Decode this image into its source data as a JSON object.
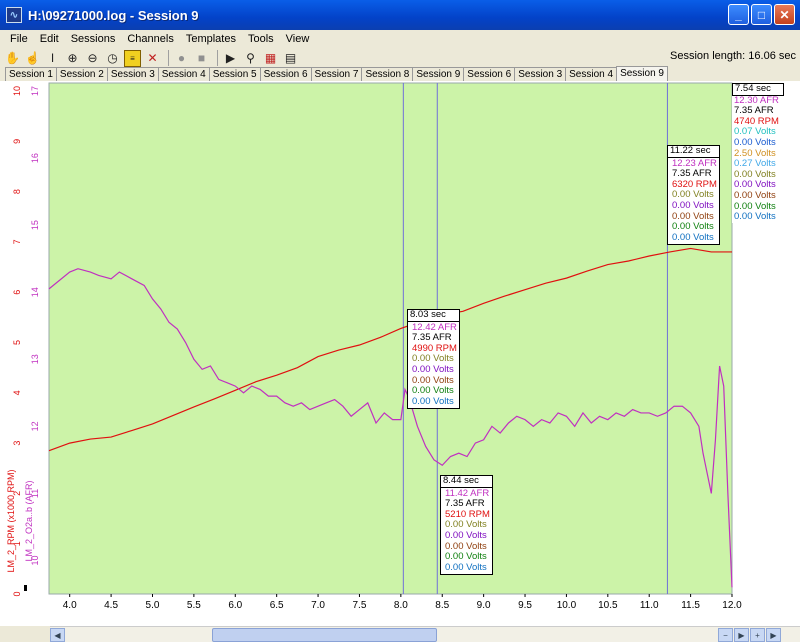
{
  "window": {
    "title": "H:\\09271000.log - Session 9"
  },
  "menu": [
    "File",
    "Edit",
    "Sessions",
    "Channels",
    "Templates",
    "Tools",
    "View"
  ],
  "toolbar_icons": [
    "hand-icon",
    "pointer-hand-icon",
    "text-cursor-icon",
    "zoom-in-icon",
    "zoom-out-icon",
    "clock-icon",
    "notes-icon",
    "cross-icon",
    "record-icon",
    "stop-icon",
    "play-icon",
    "binoculars-icon",
    "graph-icon",
    "table-icon"
  ],
  "session_length_label": "Session length:  16.06 sec",
  "tabs": [
    "Session 1",
    "Session 2",
    "Session 3",
    "Session 4",
    "Session 5",
    "Session 6",
    "Session 7",
    "Session 8",
    "Session 9",
    "Session 6",
    "Session 3",
    "Session 4",
    "Session 9"
  ],
  "active_tab_index": 12,
  "colors": {
    "plot_bg": "#ccf3a8",
    "rpm": "#e01010",
    "afr": "#c030c0",
    "cursor": "#7070d8",
    "sec": "#000000",
    "afr_black": "#000000",
    "volts_cyan": "#20c0c0",
    "volts_blue": "#1a5cd0",
    "volts_orange": "#d09020",
    "volts_lightblue": "#40a8e8",
    "volts_olive": "#808020",
    "volts_purple": "#8010c0",
    "volts_brown": "#904010",
    "volts_green": "#108010",
    "volts_steel": "#1070c0"
  },
  "chart_data": {
    "type": "line",
    "x_axis": {
      "min": 3.75,
      "max": 12.0,
      "ticks": [
        "4.0",
        "4.5",
        "5.0",
        "5.5",
        "6.0",
        "6.5",
        "7.0",
        "7.5",
        "8.0",
        "8.5",
        "9.0",
        "9.5",
        "10.0",
        "10.5",
        "11.0",
        "11.5",
        "12.0"
      ]
    },
    "y_axis_rpm": {
      "label": "LM_2_RPM (x1000 RPM)",
      "min": 0,
      "max": 10,
      "ticks": [
        "0",
        "1",
        "2",
        "3",
        "4",
        "5",
        "6",
        "7",
        "8",
        "9",
        "10"
      ]
    },
    "y_axis_afr": {
      "label": "LM_2_O2a..b (AFR)",
      "min": 9.5,
      "max": 17.0,
      "ticks": [
        "10",
        "11",
        "12",
        "13",
        "14",
        "15",
        "16",
        "17"
      ]
    },
    "series": [
      {
        "name": "LM_2_RPM",
        "x": [
          3.75,
          4.0,
          4.25,
          4.5,
          4.75,
          5.0,
          5.25,
          5.5,
          5.75,
          6.0,
          6.25,
          6.5,
          6.75,
          7.0,
          7.25,
          7.5,
          7.75,
          8.0,
          8.25,
          8.5,
          8.75,
          9.0,
          9.25,
          9.5,
          9.75,
          10.0,
          10.25,
          10.5,
          10.75,
          11.0,
          11.25,
          11.5,
          11.75,
          12.0
        ],
        "values": [
          2.85,
          3.0,
          3.08,
          3.12,
          3.25,
          3.38,
          3.55,
          3.72,
          3.88,
          4.05,
          4.22,
          4.35,
          4.5,
          4.72,
          4.85,
          4.95,
          5.1,
          5.28,
          5.42,
          5.55,
          5.62,
          5.78,
          5.92,
          6.05,
          6.18,
          6.28,
          6.42,
          6.55,
          6.62,
          6.72,
          6.8,
          6.87,
          6.8,
          6.8
        ]
      },
      {
        "name": "LM_2_O2a..b",
        "x": [
          3.75,
          4.0,
          4.1,
          4.25,
          4.35,
          4.5,
          4.6,
          4.75,
          4.9,
          5.0,
          5.1,
          5.2,
          5.3,
          5.4,
          5.5,
          5.6,
          5.7,
          5.8,
          5.9,
          6.0,
          6.1,
          6.2,
          6.3,
          6.4,
          6.5,
          6.6,
          6.7,
          6.8,
          6.9,
          7.0,
          7.1,
          7.2,
          7.3,
          7.4,
          7.5,
          7.6,
          7.7,
          7.8,
          7.9,
          8.0,
          8.05,
          8.1,
          8.2,
          8.3,
          8.4,
          8.5,
          8.6,
          8.7,
          8.8,
          8.9,
          9.0,
          9.1,
          9.2,
          9.3,
          9.4,
          9.5,
          9.6,
          9.7,
          9.8,
          9.9,
          10.0,
          10.1,
          10.2,
          10.3,
          10.4,
          10.5,
          10.6,
          10.7,
          10.8,
          10.9,
          11.0,
          11.1,
          11.2,
          11.3,
          11.4,
          11.5,
          11.6,
          11.65,
          11.7,
          11.75,
          11.8,
          11.85,
          11.9,
          11.95,
          12.0
        ],
        "values": [
          14.05,
          14.3,
          14.35,
          14.3,
          14.25,
          14.2,
          14.3,
          14.2,
          14.1,
          13.9,
          13.75,
          13.55,
          13.45,
          13.25,
          13.0,
          12.85,
          12.9,
          12.7,
          12.65,
          12.6,
          12.5,
          12.6,
          12.55,
          12.45,
          12.45,
          12.35,
          12.3,
          12.35,
          12.25,
          12.3,
          12.35,
          12.4,
          12.3,
          12.15,
          12.25,
          12.35,
          12.05,
          12.2,
          12.1,
          12.1,
          12.55,
          12.42,
          12.0,
          11.7,
          11.5,
          11.42,
          11.55,
          11.6,
          11.55,
          11.75,
          11.8,
          12.0,
          11.9,
          12.05,
          12.15,
          12.1,
          12.0,
          12.1,
          12.05,
          12.2,
          12.15,
          12.0,
          12.2,
          12.05,
          12.15,
          12.1,
          12.2,
          12.15,
          12.25,
          12.2,
          12.2,
          12.15,
          12.2,
          12.3,
          12.3,
          12.2,
          12.0,
          11.6,
          11.3,
          11.0,
          11.8,
          12.9,
          12.6,
          11.0,
          9.6
        ]
      }
    ],
    "cursors": [
      8.03,
      8.44,
      11.22
    ]
  },
  "tooltips": [
    {
      "sec": "8.03 sec",
      "afr_main": "12.42 AFR",
      "afr_black": "7.35 AFR",
      "rpm": "4990 RPM",
      "v1": "0.00 Volts",
      "v2": "0.00 Volts",
      "v3": "0.00 Volts",
      "v4": "0.00 Volts",
      "v5": "0.00 Volts"
    },
    {
      "sec": "8.44 sec",
      "afr_main": "11.42 AFR",
      "afr_black": "7.35 AFR",
      "rpm": "5210 RPM",
      "v1": "0.00 Volts",
      "v2": "0.00 Volts",
      "v3": "0.00 Volts",
      "v4": "0.00 Volts",
      "v5": "0.00 Volts"
    },
    {
      "sec": "11.22 sec",
      "afr_main": "12.23 AFR",
      "afr_black": "7.35 AFR",
      "rpm": "6320 RPM",
      "v1": "0.00 Volts",
      "v2": "0.00 Volts",
      "v3": "0.00 Volts",
      "v4": "0.00 Volts",
      "v5": "0.00 Volts"
    }
  ],
  "legend": {
    "sec": "7.54 sec",
    "rows": [
      "12.30 AFR",
      "7.35 AFR",
      "4740 RPM",
      "0.07 Volts",
      "0.00 Volts",
      "2.50 Volts",
      "0.27 Volts",
      "0.00 Volts",
      "0.00 Volts",
      "0.00 Volts",
      "0.00 Volts",
      "0.00 Volts"
    ]
  }
}
